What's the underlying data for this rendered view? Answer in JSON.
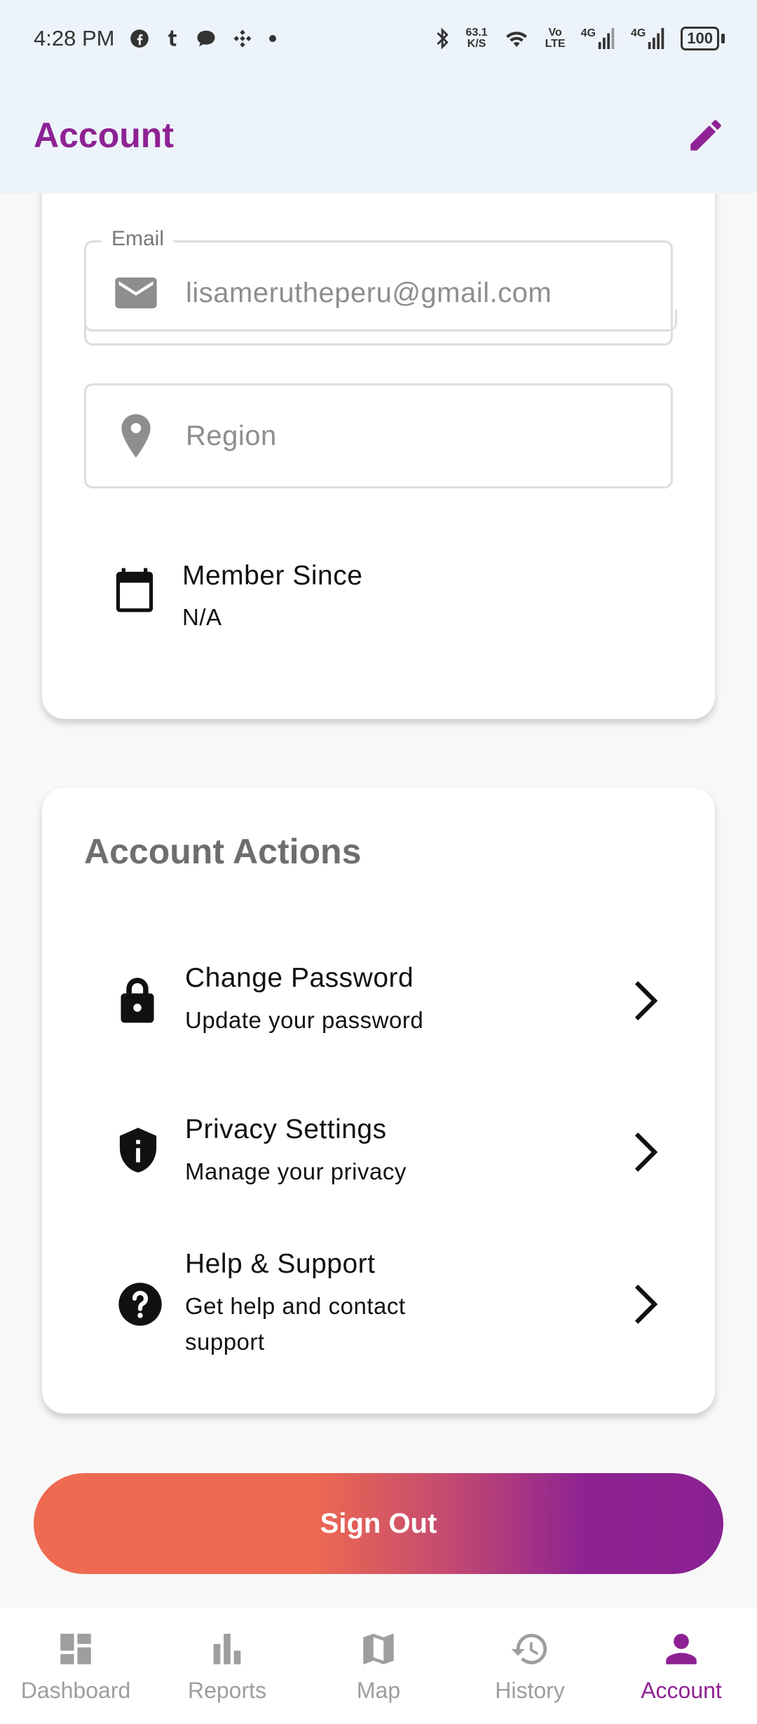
{
  "status_bar": {
    "time": "4:28 PM",
    "speed_value": "63.1",
    "speed_unit": "K/S",
    "volte_top": "Vo",
    "volte_bottom": "LTE",
    "net1": "4G",
    "net2": "4G",
    "battery": "100"
  },
  "app_bar": {
    "title": "Account",
    "edit_icon": "pencil-icon"
  },
  "profile": {
    "email_label": "Email",
    "email_value": "lisamerutheperu@gmail.com",
    "region_placeholder": "Region",
    "member_since_label": "Member Since",
    "member_since_value": "N/A"
  },
  "account_actions": {
    "title": "Account Actions",
    "items": [
      {
        "title": "Change Password",
        "subtitle": "Update your password",
        "icon": "lock-icon"
      },
      {
        "title": "Privacy Settings",
        "subtitle": "Manage your privacy",
        "icon": "shield-icon"
      },
      {
        "title": "Help & Support",
        "subtitle": "Get help and contact support",
        "icon": "help-icon"
      }
    ]
  },
  "sign_out": {
    "label": "Sign Out"
  },
  "bottom_nav": {
    "items": [
      {
        "label": "Dashboard",
        "icon": "dashboard-icon",
        "active": false
      },
      {
        "label": "Reports",
        "icon": "bar-chart-icon",
        "active": false
      },
      {
        "label": "Map",
        "icon": "map-icon",
        "active": false
      },
      {
        "label": "History",
        "icon": "history-icon",
        "active": false
      },
      {
        "label": "Account",
        "icon": "person-icon",
        "active": true
      }
    ]
  },
  "colors": {
    "accent": "#8e2293",
    "gradient_start": "#ee6a50",
    "header_bg": "#edf3fa"
  }
}
